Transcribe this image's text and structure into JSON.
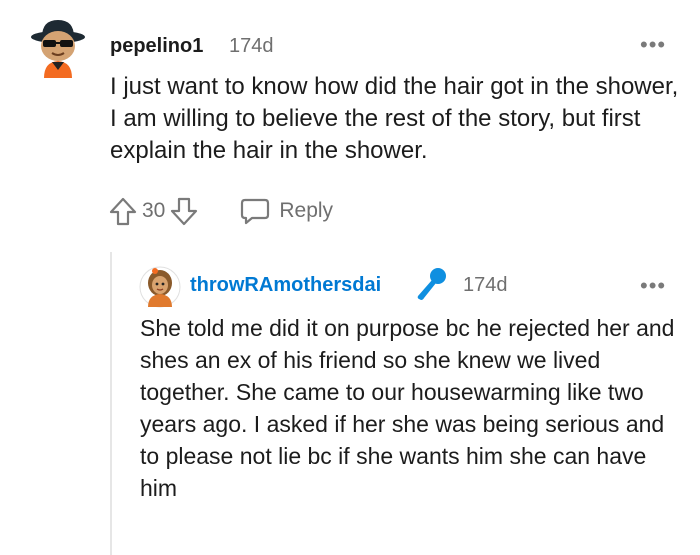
{
  "comment": {
    "username": "pepelino1",
    "timestamp": "174d",
    "more_label": "•••",
    "body": "I just want to know how did the hair got in the shower, I am willing to believe the rest of the story, but first explain the hair in the shower.",
    "vote_count": "30",
    "reply_label": "Reply"
  },
  "reply": {
    "username": "throwRAmothersdai",
    "timestamp": "174d",
    "more_label": "•••",
    "body": "She told me did it on purpose bc he rejected her and shes an ex of his friend so she knew we lived together. She came to our housewarming like two years ago. I asked if her she was being serious and to please not lie bc if she wants him she can have him"
  },
  "icons": {
    "upvote": "arrow-up-outline-icon",
    "downvote": "arrow-down-outline-icon",
    "reply": "speech-bubble-icon",
    "flair": "microphone-icon"
  },
  "colors": {
    "reply_username": "#0079d3",
    "mic": "#0f8fe0",
    "meta": "#6f6f6f"
  }
}
